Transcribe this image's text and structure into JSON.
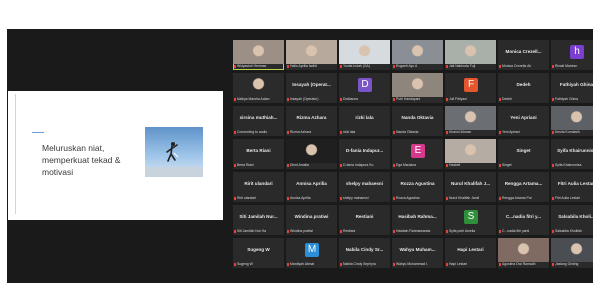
{
  "slide": {
    "text": "Meluruskan niat,\nmemperkuat tekad &\nmotivasi",
    "image": "businessman-launching-upward-illustration"
  },
  "participants": [
    {
      "display": "video",
      "bg": "#9b8f86",
      "caption": "Widyastuti Hermaw"
    },
    {
      "display": "video",
      "bg": "#b7a99c",
      "caption": "Hallo Aprilia fadhil"
    },
    {
      "display": "video",
      "bg": "#d6dbe0",
      "caption": "Yunita Indah (GA)"
    },
    {
      "display": "video",
      "bg": "#8a8f95",
      "caption": "Roganti Ayu A"
    },
    {
      "display": "video",
      "bg": "#a9b0aa",
      "caption": "Jati Nakhuda Fuji"
    },
    {
      "display": "name",
      "name": "Monica Crezell...",
      "caption": "Monica Crezella Ah"
    },
    {
      "display": "avatar",
      "letter": "h",
      "avatar_color": "#7a3fd0",
      "caption": "Rizaki Mahesn"
    },
    {
      "display": "video",
      "bg": "#2b2b2b",
      "caption": "Naibya Marsha Adam"
    },
    {
      "display": "name",
      "name": "Insayah (Operat...",
      "caption": "Insayah (Operator)"
    },
    {
      "display": "avatar",
      "letter": "D",
      "avatar_color": "#7a55c8",
      "caption": "Dwibacea"
    },
    {
      "display": "video",
      "bg": "#8e857c",
      "caption": "Putri Handayani"
    },
    {
      "display": "avatar",
      "letter": "F",
      "avatar_color": "#e4572e",
      "caption": "Juli Fitriyani"
    },
    {
      "display": "name",
      "name": "Dedeh",
      "caption": "Dedeh"
    },
    {
      "display": "name",
      "name": "Fathiyah Ghina",
      "caption": "Fathiyah Ghina"
    },
    {
      "display": "name",
      "name": "sirsina muthiah...",
      "caption": "Connecting to audio"
    },
    {
      "display": "name",
      "name": "Rizma Azhara",
      "caption": "Rizma Azhara"
    },
    {
      "display": "name",
      "name": "rizki lala",
      "caption": "rizki lala"
    },
    {
      "display": "name",
      "name": "Nanda Oktavia",
      "caption": "Nanda Oktavia"
    },
    {
      "display": "video",
      "bg": "#6b6f73",
      "caption": "Khairul Ikhwan"
    },
    {
      "display": "name",
      "name": "Yeni Apriani",
      "caption": "Yeni Apriani"
    },
    {
      "display": "video",
      "bg": "#5d6166",
      "caption": "Novita Kurniasih"
    },
    {
      "display": "name",
      "name": "Berta Riani",
      "caption": "Berta Riani"
    },
    {
      "display": "video",
      "bg": "#1f1f1f",
      "caption": "Dinni Amalia"
    },
    {
      "display": "name",
      "name": "D-fania Indapur...",
      "caption": "D-fania Indapura Ku"
    },
    {
      "display": "avatar",
      "letter": "E",
      "avatar_color": "#d63a8d",
      "caption": "Ega Maulana"
    },
    {
      "display": "video",
      "bg": "#b5aca4",
      "caption": "Hasbiel"
    },
    {
      "display": "name",
      "name": "Singet",
      "caption": "Singet"
    },
    {
      "display": "name",
      "name": "Syifa Khairunnisa",
      "caption": "Syifa Khairunnisa"
    },
    {
      "display": "name",
      "name": "Ririt ulandari",
      "caption": "Ririt ulandari"
    },
    {
      "display": "name",
      "name": "Annisa Aprilia",
      "caption": "Annisa Aprilia"
    },
    {
      "display": "name",
      "name": "shelpy mahaesni",
      "caption": "shelpy mahaesni"
    },
    {
      "display": "name",
      "name": "Rozza Agustina",
      "caption": "Rozza Agustina"
    },
    {
      "display": "name",
      "name": "Nurul Khalifah J...",
      "caption": "Nurul Khalifah Jamil"
    },
    {
      "display": "name",
      "name": "Rengga Artama...",
      "caption": "Rengga Artama Put"
    },
    {
      "display": "name",
      "name": "Fitri Aulia Lestari",
      "caption": "Fitri Aulia Lestari"
    },
    {
      "display": "name",
      "name": "Siti Jamilah Nur...",
      "caption": "Siti Jamilah Nur Ha"
    },
    {
      "display": "name",
      "name": "Windina pratiwi",
      "caption": "Windina pratiwi"
    },
    {
      "display": "name",
      "name": "Restiani",
      "caption": "Restiani"
    },
    {
      "display": "name",
      "name": "Hasibah Rahma...",
      "caption": "Hasibah Rahmawanda"
    },
    {
      "display": "avatar",
      "letter": "S",
      "avatar_color": "#2f8f3a",
      "caption": "Syifa putri Amelia"
    },
    {
      "display": "name",
      "name": "C...nadia fitri y...",
      "caption": "C...nadia fitri yanti"
    },
    {
      "display": "name",
      "name": "Salsabila Kholi...",
      "caption": "Salsabila Kholifah"
    },
    {
      "display": "name",
      "name": "Sugeng W",
      "caption": "Sugeng W"
    },
    {
      "display": "avatar",
      "letter": "M",
      "avatar_color": "#2a8fd6",
      "caption": "Mardiyah Akmal"
    },
    {
      "display": "name",
      "name": "Nabila Cindy Sr...",
      "caption": "Nabila Cindy Sephyra"
    },
    {
      "display": "name",
      "name": "Wahyu Muham...",
      "caption": "Wahyu Muhammad I."
    },
    {
      "display": "name",
      "name": "Hapi Lestari",
      "caption": "Hapi Lestari"
    },
    {
      "display": "video",
      "bg": "#7f6b62",
      "caption": "Agustina Dwi Ramadh"
    },
    {
      "display": "video",
      "bg": "#4a4d52",
      "caption": "Jaslang Ginting"
    }
  ]
}
